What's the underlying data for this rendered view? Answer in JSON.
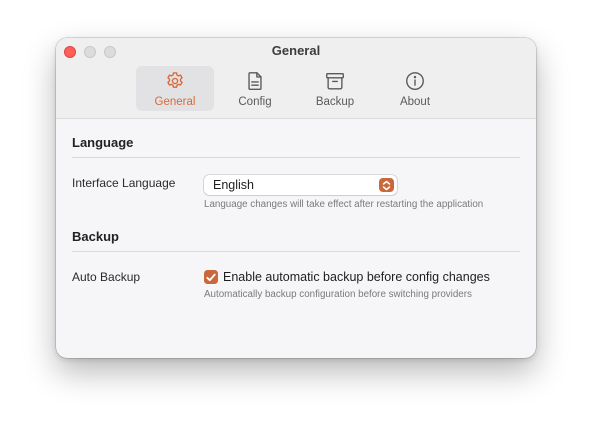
{
  "window": {
    "title": "General"
  },
  "tabs": [
    {
      "label": "General",
      "icon": "gear-icon",
      "active": true
    },
    {
      "label": "Config",
      "icon": "document-icon",
      "active": false
    },
    {
      "label": "Backup",
      "icon": "archive-box-icon",
      "active": false
    },
    {
      "label": "About",
      "icon": "info-circle-icon",
      "active": false
    }
  ],
  "language_section": {
    "title": "Language",
    "interface_language": {
      "label": "Interface Language",
      "selected": "English",
      "help": "Language changes will take effect after restarting the application"
    }
  },
  "backup_section": {
    "title": "Backup",
    "auto_backup": {
      "label": "Auto Backup",
      "checkbox_label": "Enable automatic backup before config changes",
      "checked": true,
      "help": "Automatically backup configuration before switching providers"
    }
  },
  "colors": {
    "accent": "#c9683a",
    "active_tab_text": "#d86a3a",
    "close_button": "#ff5f57"
  }
}
